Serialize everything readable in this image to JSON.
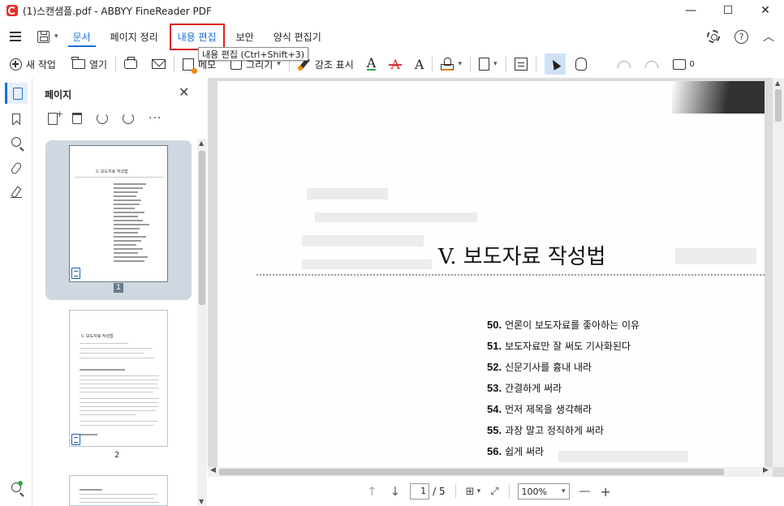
{
  "window": {
    "title": "(1)스캔샘플.pdf - ABBYY FineReader PDF",
    "minimize": "—",
    "maximize": "☐",
    "close": "✕"
  },
  "menu": {
    "tabs": [
      {
        "label": "문서"
      },
      {
        "label": "페이지 정리"
      },
      {
        "label": "내용 편집"
      },
      {
        "label": "보안"
      },
      {
        "label": "양식 편집기"
      }
    ],
    "help": "?"
  },
  "tooltip": "내용 편집 (Ctrl+Shift+3)",
  "toolbar": {
    "new_task": "새 작업",
    "open": "열기",
    "note": "메모",
    "draw": "그리기",
    "highlight": "강조 표시",
    "text_underline": "A",
    "text_strike": "A",
    "text_insert": "A",
    "comments_count": "0"
  },
  "pages_panel": {
    "title": "페이지",
    "close": "✕",
    "more": "···",
    "thumb_title": "V. 보도자료 작성법",
    "page1_label": "1",
    "page2_label": "2"
  },
  "document": {
    "title": "V. 보도자료 작성법",
    "toc": [
      {
        "num": "50.",
        "text": "언론이 보도자료를 좋아하는 이유"
      },
      {
        "num": "51.",
        "text": "보도자료만 잘 써도 기사화된다"
      },
      {
        "num": "52.",
        "text": "신문기사를 흉내 내라"
      },
      {
        "num": "53.",
        "text": "간결하게 써라"
      },
      {
        "num": "54.",
        "text": "먼저 제목을 생각해라"
      },
      {
        "num": "55.",
        "text": "과장 말고 정직하게 써라"
      },
      {
        "num": "56.",
        "text": "쉽게 써라"
      }
    ]
  },
  "statusbar": {
    "page_current": "1",
    "page_total": "/ 5",
    "zoom": "100%",
    "zoom_out": "—",
    "zoom_in": "+"
  },
  "colors": {
    "accent": "#1a6fd6",
    "highlight_box": "#e02020",
    "logo": "#e0312d"
  }
}
